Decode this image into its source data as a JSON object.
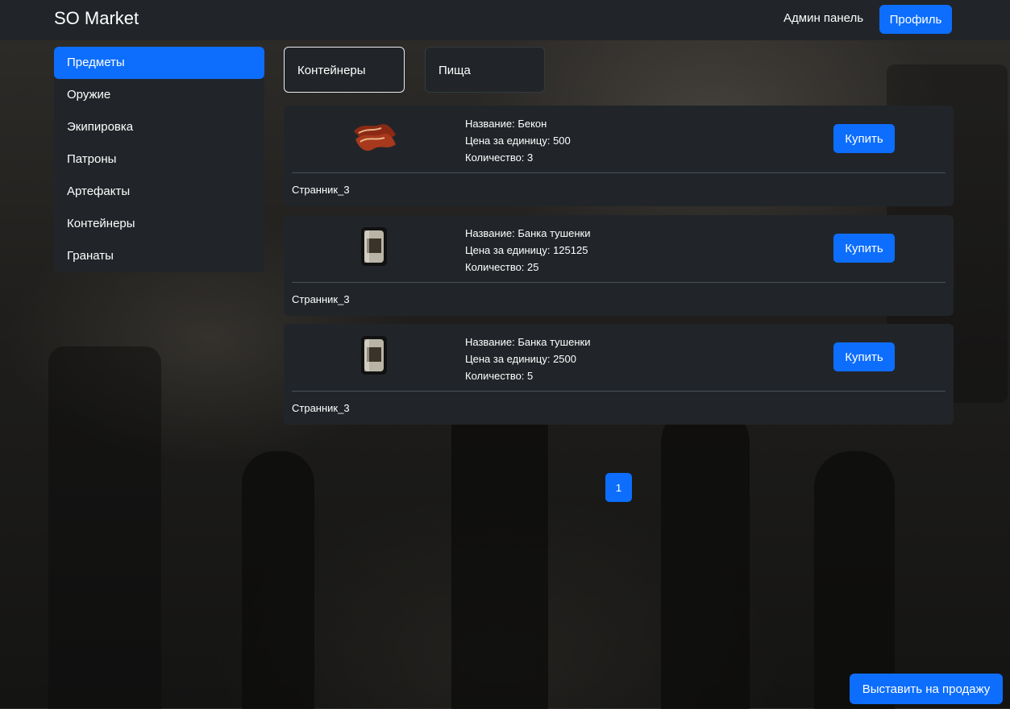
{
  "header": {
    "brand": "SO Market",
    "admin_label": "Админ панель",
    "profile_label": "Профиль"
  },
  "sidebar": {
    "items": [
      {
        "label": "Предметы",
        "active": true
      },
      {
        "label": "Оружие",
        "active": false
      },
      {
        "label": "Экипировка",
        "active": false
      },
      {
        "label": "Патроны",
        "active": false
      },
      {
        "label": "Артефакты",
        "active": false
      },
      {
        "label": "Контейнеры",
        "active": false
      },
      {
        "label": "Гранаты",
        "active": false
      }
    ]
  },
  "subcategories": [
    {
      "label": "Контейнеры",
      "selected": true
    },
    {
      "label": "Пища",
      "selected": false
    }
  ],
  "listings": [
    {
      "name_line": "Название: Бекон",
      "price_line": "Цена за единицу: 500",
      "qty_line": "Количество: 3",
      "seller": "Странник_3",
      "buy_label": "Купить",
      "icon": "bacon-icon"
    },
    {
      "name_line": "Название: Банка тушенки",
      "price_line": "Цена за единицу: 125125",
      "qty_line": "Количество: 25",
      "seller": "Странник_3",
      "buy_label": "Купить",
      "icon": "canned-meat-icon"
    },
    {
      "name_line": "Название: Банка тушенки",
      "price_line": "Цена за единицу: 2500",
      "qty_line": "Количество: 5",
      "seller": "Странник_3",
      "buy_label": "Купить",
      "icon": "canned-meat-icon"
    }
  ],
  "pagination": {
    "current": "1"
  },
  "sell_button_label": "Выставить на продажу",
  "colors": {
    "primary": "#0d6efd",
    "panel": "#212529",
    "text": "#ffffff"
  }
}
